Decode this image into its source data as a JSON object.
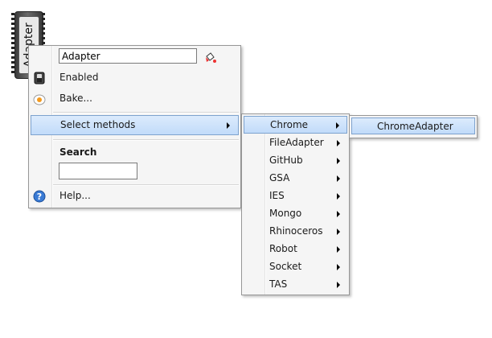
{
  "component": {
    "label": "Adapter"
  },
  "main_menu": {
    "name_value": "Adapter",
    "enabled_label": "Enabled",
    "bake_label": "Bake...",
    "select_methods_label": "Select  methods",
    "search_label": "Search",
    "search_value": "",
    "help_label": "Help..."
  },
  "sub_menu": {
    "items": [
      {
        "label": "Chrome"
      },
      {
        "label": "FileAdapter"
      },
      {
        "label": "GitHub"
      },
      {
        "label": "GSA"
      },
      {
        "label": "IES"
      },
      {
        "label": "Mongo"
      },
      {
        "label": "Rhinoceros"
      },
      {
        "label": "Robot"
      },
      {
        "label": "Socket"
      },
      {
        "label": "TAS"
      }
    ]
  },
  "sub_sub_menu": {
    "items": [
      {
        "label": "ChromeAdapter"
      }
    ]
  },
  "colors": {
    "highlight": "#c1dbfa",
    "highlight_border": "#7da2ce",
    "menu_bg": "#f5f5f5"
  }
}
